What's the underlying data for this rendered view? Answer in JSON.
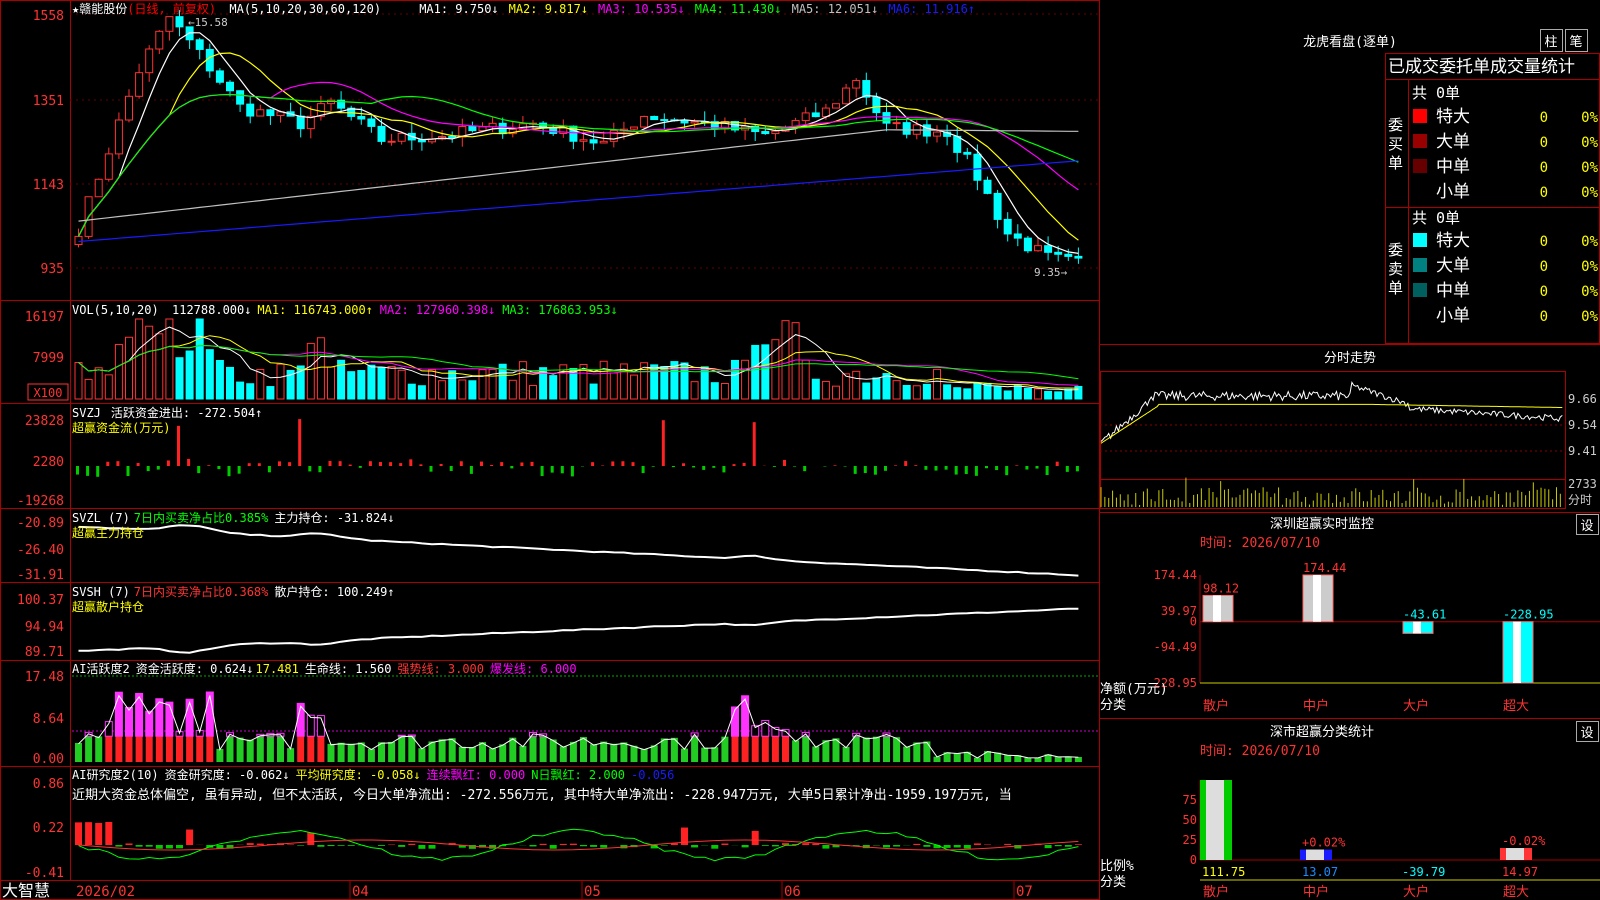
{
  "header": {
    "title": "★赣能股份",
    "title_suffix": "(日线, 前复权)",
    "ma_label": "MA(5,10,20,30,60,120)",
    "ma_values": [
      {
        "label": "MA1: 9.750↓",
        "color": "#ffffff"
      },
      {
        "label": "MA2: 9.817↓",
        "color": "#ffff00"
      },
      {
        "label": "MA3: 10.535↓",
        "color": "#ff00ff"
      },
      {
        "label": "MA4: 11.430↓",
        "color": "#00ff00"
      },
      {
        "label": "MA5: 12.051↓",
        "color": "#c0c0c0"
      },
      {
        "label": "MA6: 11.916↑",
        "color": "#1a1aff"
      }
    ],
    "high_marker": "15.58",
    "low_marker": "9.35"
  },
  "price_axis": [
    "1558",
    "1351",
    "1143",
    "935"
  ],
  "vol_header": {
    "name": "VOL(5,10,20)",
    "items": [
      {
        "label": "112788.000↓",
        "color": "#ffffff"
      },
      {
        "label": "MA1: 116743.000↑",
        "color": "#ffff00"
      },
      {
        "label": "MA2: 127960.398↓",
        "color": "#ff00ff"
      },
      {
        "label": "MA3: 176863.953↓",
        "color": "#00ff00"
      }
    ],
    "axis": [
      "16197",
      "7999"
    ],
    "unit": "X100"
  },
  "svzj": {
    "name": "SVZJ",
    "item": "活跃资金进出: -272.504↑",
    "sub": "超赢资金流(万元)",
    "axis": [
      "23828",
      "2280",
      "-19268"
    ]
  },
  "svzl": {
    "name": "SVZL (7)",
    "item1": "7日内买卖净占比0.385%",
    "item2": "主力持仓: -31.824↓",
    "sub": "超赢主力持仓",
    "axis": [
      "-20.89",
      "-26.40",
      "-31.91"
    ]
  },
  "svsh": {
    "name": "SVSH (7)",
    "item1": "7日内买卖净占比0.368%",
    "item2": "散户持仓: 100.249↑",
    "sub": "超赢散户持仓",
    "axis": [
      "100.37",
      "94.94",
      "89.71"
    ]
  },
  "ai1": {
    "name": "AI活跃度2",
    "item1": "资金活跃度: 0.624↓",
    "item2": "17.481",
    "item3": "生命线: 1.560",
    "item4": "强势线: 3.000",
    "item5": "爆发线: 6.000",
    "axis": [
      "17.48",
      "8.64",
      "0.00"
    ]
  },
  "ai2": {
    "name": "AI研究度2(10)",
    "item1": "资金研究度: -0.062↓",
    "item2": "平均研究度: -0.058↓",
    "item3": "连续飘红: 0.000",
    "item4": "N日飘红: 2.000",
    "item5": "-0.056",
    "axis": [
      "0.86",
      "0.22",
      "-0.41"
    ],
    "note": "近期大资金总体偏空, 虽有异动, 但不太活跃, 今日大单净流出: -272.556万元, 其中特大单净流出: -228.947万元, 大单5日累计净出-1959.197万元, 当"
  },
  "footer": {
    "brand": "大智慧",
    "dates": [
      "2026/02",
      "04",
      "05",
      "06",
      "07"
    ]
  },
  "right": {
    "lhb_title": "龙虎看盘(逐单)",
    "btn_zhu": "柱",
    "btn_bi": "笔",
    "tab_title": "已成交委托单成交量统计",
    "buy_group": "委买单",
    "sell_group": "委卖单",
    "buy_total": "共 0单",
    "sell_total": "共 0单",
    "buy_rows": [
      {
        "label": "特大",
        "count": "0",
        "pct": "0%",
        "color": "#ff0000"
      },
      {
        "label": "大单",
        "count": "0",
        "pct": "0%",
        "color": "#990000"
      },
      {
        "label": "中单",
        "count": "0",
        "pct": "0%",
        "color": "#660000"
      },
      {
        "label": "小单",
        "count": "0",
        "pct": "0%",
        "color": ""
      }
    ],
    "sell_rows": [
      {
        "label": "特大",
        "count": "0",
        "pct": "0%",
        "color": "#00ffff"
      },
      {
        "label": "大单",
        "count": "0",
        "pct": "0%",
        "color": "#008080"
      },
      {
        "label": "中单",
        "count": "0",
        "pct": "0%",
        "color": "#006060"
      },
      {
        "label": "小单",
        "count": "0",
        "pct": "0%",
        "color": ""
      }
    ],
    "fenshi_title": "分时走势",
    "fenshi_axis": [
      "9.66",
      "9.54",
      "9.41"
    ],
    "fenshi_vol": "2733",
    "fenshi_tag": "分时",
    "sz_title": "深圳超赢实时监控",
    "sz_btn": "设",
    "sz_time": "时间: 2026/07/10",
    "sz_axis": [
      "174.44",
      "39.97",
      "0",
      "-94.49",
      "-228.95"
    ],
    "sz_ylabel": "净额(万元)",
    "sz_xlabel": "分类",
    "sz_cats": [
      "散户",
      "中户",
      "大户",
      "超大"
    ],
    "sz_values": [
      "98.12",
      "174.44",
      "-43.61",
      "-228.95"
    ],
    "fl_title": "深市超赢分类统计",
    "fl_btn": "设",
    "fl_time": "时间: 2026/07/10",
    "fl_axis": [
      "75",
      "50",
      "25",
      "0"
    ],
    "fl_ylabel": "比例%",
    "fl_xlabel": "分类",
    "fl_cats": [
      "散户",
      "中户",
      "大户",
      "超大"
    ],
    "fl_values": [
      "111.75",
      "13.07",
      "-39.79",
      "14.97"
    ],
    "fl_bar_labels": [
      "",
      "+0.02%",
      "",
      "-0.02%"
    ]
  },
  "chart_data": [
    {
      "type": "bar",
      "title": "深圳超赢实时监控",
      "categories": [
        "散户",
        "中户",
        "大户",
        "超大"
      ],
      "values": [
        98.12,
        174.44,
        -43.61,
        -228.95
      ],
      "ylabel": "净额(万元)",
      "xlabel": "分类",
      "ylim": [
        -228.95,
        174.44
      ]
    },
    {
      "type": "bar",
      "title": "深市超赢分类统计",
      "categories": [
        "散户",
        "中户",
        "大户",
        "超大"
      ],
      "values": [
        111.75,
        13.07,
        -39.79,
        14.97
      ],
      "ylabel": "比例%",
      "xlabel": "分类",
      "ylim": [
        0,
        75
      ]
    },
    {
      "type": "line",
      "title": "MA(5,10,20,30,60,120)",
      "ylim": [
        9.35,
        15.58
      ],
      "series": [
        {
          "name": "MA1",
          "last": 9.75
        },
        {
          "name": "MA2",
          "last": 9.817
        },
        {
          "name": "MA3",
          "last": 10.535
        },
        {
          "name": "MA4",
          "last": 11.43
        },
        {
          "name": "MA5",
          "last": 12.051
        },
        {
          "name": "MA6",
          "last": 11.916
        }
      ]
    }
  ]
}
